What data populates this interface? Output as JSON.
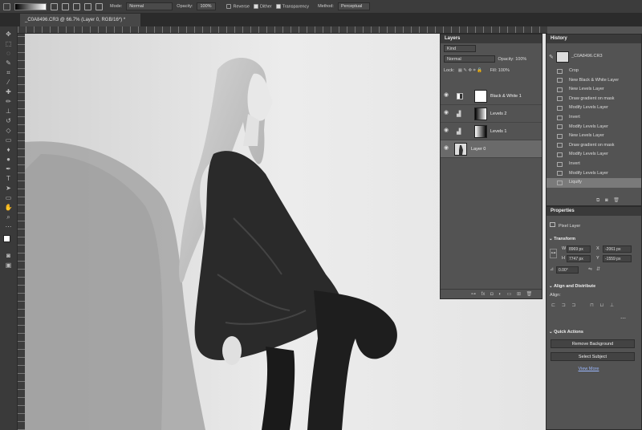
{
  "options_bar": {
    "mode_label": "Mode:",
    "mode_value": "Normal",
    "opacity_label": "Opacity:",
    "opacity_value": "100%",
    "reverse_label": "Reverse",
    "dither_label": "Dither",
    "transparency_label": "Transparency",
    "method_label": "Method:",
    "method_value": "Perceptual"
  },
  "document_tab": {
    "title": "_C0A8496.CR3 @ 66.7% (Layer 0, RGB/16*) *"
  },
  "layers_panel": {
    "title": "Layers",
    "filter_value": "Kind",
    "blend_mode": "Normal",
    "opacity_label": "Opacity:",
    "opacity_value": "100%",
    "lock_label": "Lock:",
    "fill_label": "Fill:",
    "fill_value": "100%",
    "layers": [
      {
        "name": "Black & White 1"
      },
      {
        "name": "Levels 2"
      },
      {
        "name": "Levels 1"
      },
      {
        "name": "Layer 0"
      }
    ]
  },
  "history_panel": {
    "title": "History",
    "snapshot": "_C0A8496.CR3",
    "items": [
      "Crop",
      "New Black & White Layer",
      "New Levels Layer",
      "Draw gradient on mask",
      "Modify Levels Layer",
      "Invert",
      "Modify Levels Layer",
      "New Levels Layer",
      "Draw gradient on mask",
      "Modify Levels Layer",
      "Invert",
      "Modify Levels Layer",
      "Liquify"
    ]
  },
  "properties_panel": {
    "title": "Properties",
    "layer_type": "Pixel Layer",
    "transform_label": "Transform",
    "w_label": "W",
    "w_value": "8969 px",
    "x_label": "X",
    "x_value": "-2061 px",
    "h_label": "H",
    "h_value": "7747 px",
    "y_label": "Y",
    "y_value": "-1559 px",
    "angle_value": "0.00°",
    "align_label": "Align and Distribute",
    "align_sub": "Align:",
    "quick_actions_label": "Quick Actions",
    "remove_bg": "Remove Background",
    "select_subject": "Select Subject",
    "view_more": "View More"
  }
}
